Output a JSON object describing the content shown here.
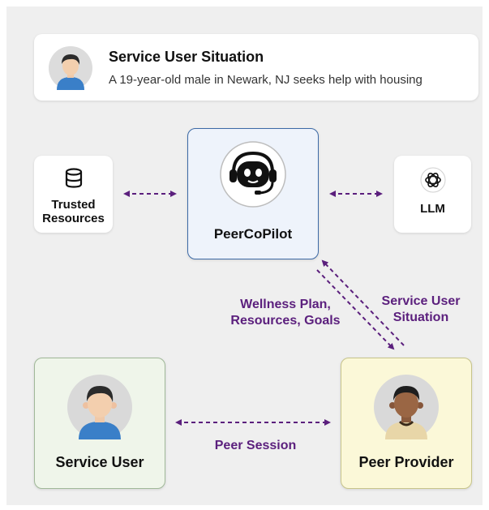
{
  "situation": {
    "title": "Service User Situation",
    "description": "A 19-year-old male in Newark, NJ seeks help with housing"
  },
  "nodes": {
    "trusted_resources": {
      "label": "Trusted Resources",
      "icon": "database-icon"
    },
    "llm": {
      "label": "LLM",
      "icon": "openai-logo-icon"
    },
    "peercopilot": {
      "label": "PeerCoPilot",
      "icon": "robot-headset-icon"
    },
    "service_user": {
      "label": "Service User",
      "icon": "person-avatar-icon"
    },
    "peer_provider": {
      "label": "Peer Provider",
      "icon": "person-avatar-icon"
    }
  },
  "edges": {
    "to_provider": "Wellness Plan, Resources, Goals",
    "to_copilot": "Service User Situation",
    "peer_session": "Peer Session"
  },
  "colors": {
    "arrow": "#5b1f7d",
    "copilot_bg": "#eef3fb",
    "copilot_border": "#3d6aa6",
    "service_user_bg": "#eff5ea",
    "peer_provider_bg": "#fbf8d8"
  }
}
